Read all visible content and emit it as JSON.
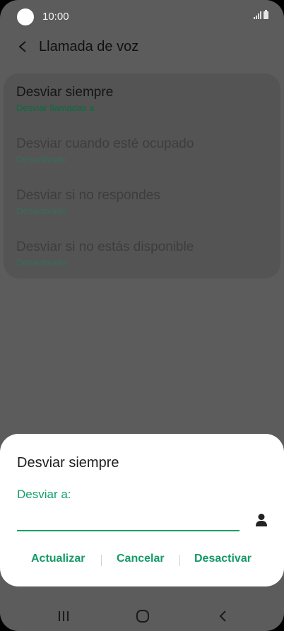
{
  "status_bar": {
    "time": "10:00"
  },
  "app_bar": {
    "title": "Llamada de voz"
  },
  "settings": {
    "items": [
      {
        "title": "Desviar siempre",
        "subtitle": "Desviar llamadas a"
      },
      {
        "title": "Desviar cuando esté ocupado",
        "subtitle": "Desactivado"
      },
      {
        "title": "Desviar si no respondes",
        "subtitle": "Desactivado"
      },
      {
        "title": "Desviar si no estás disponible",
        "subtitle": "Desactivado"
      }
    ]
  },
  "dialog": {
    "title": "Desviar siempre",
    "field_label": "Desviar a:",
    "field_value": "",
    "buttons": {
      "update": "Actualizar",
      "cancel": "Cancelar",
      "deactivate": "Desactivar"
    }
  },
  "colors": {
    "accent": "#12a06a",
    "overlay_bg": "#5c5c5c"
  },
  "icons": {
    "back": "chevron-left-icon",
    "contact": "person-icon",
    "nav_recents": "recents-icon",
    "nav_home": "home-icon",
    "nav_back": "back-icon"
  }
}
